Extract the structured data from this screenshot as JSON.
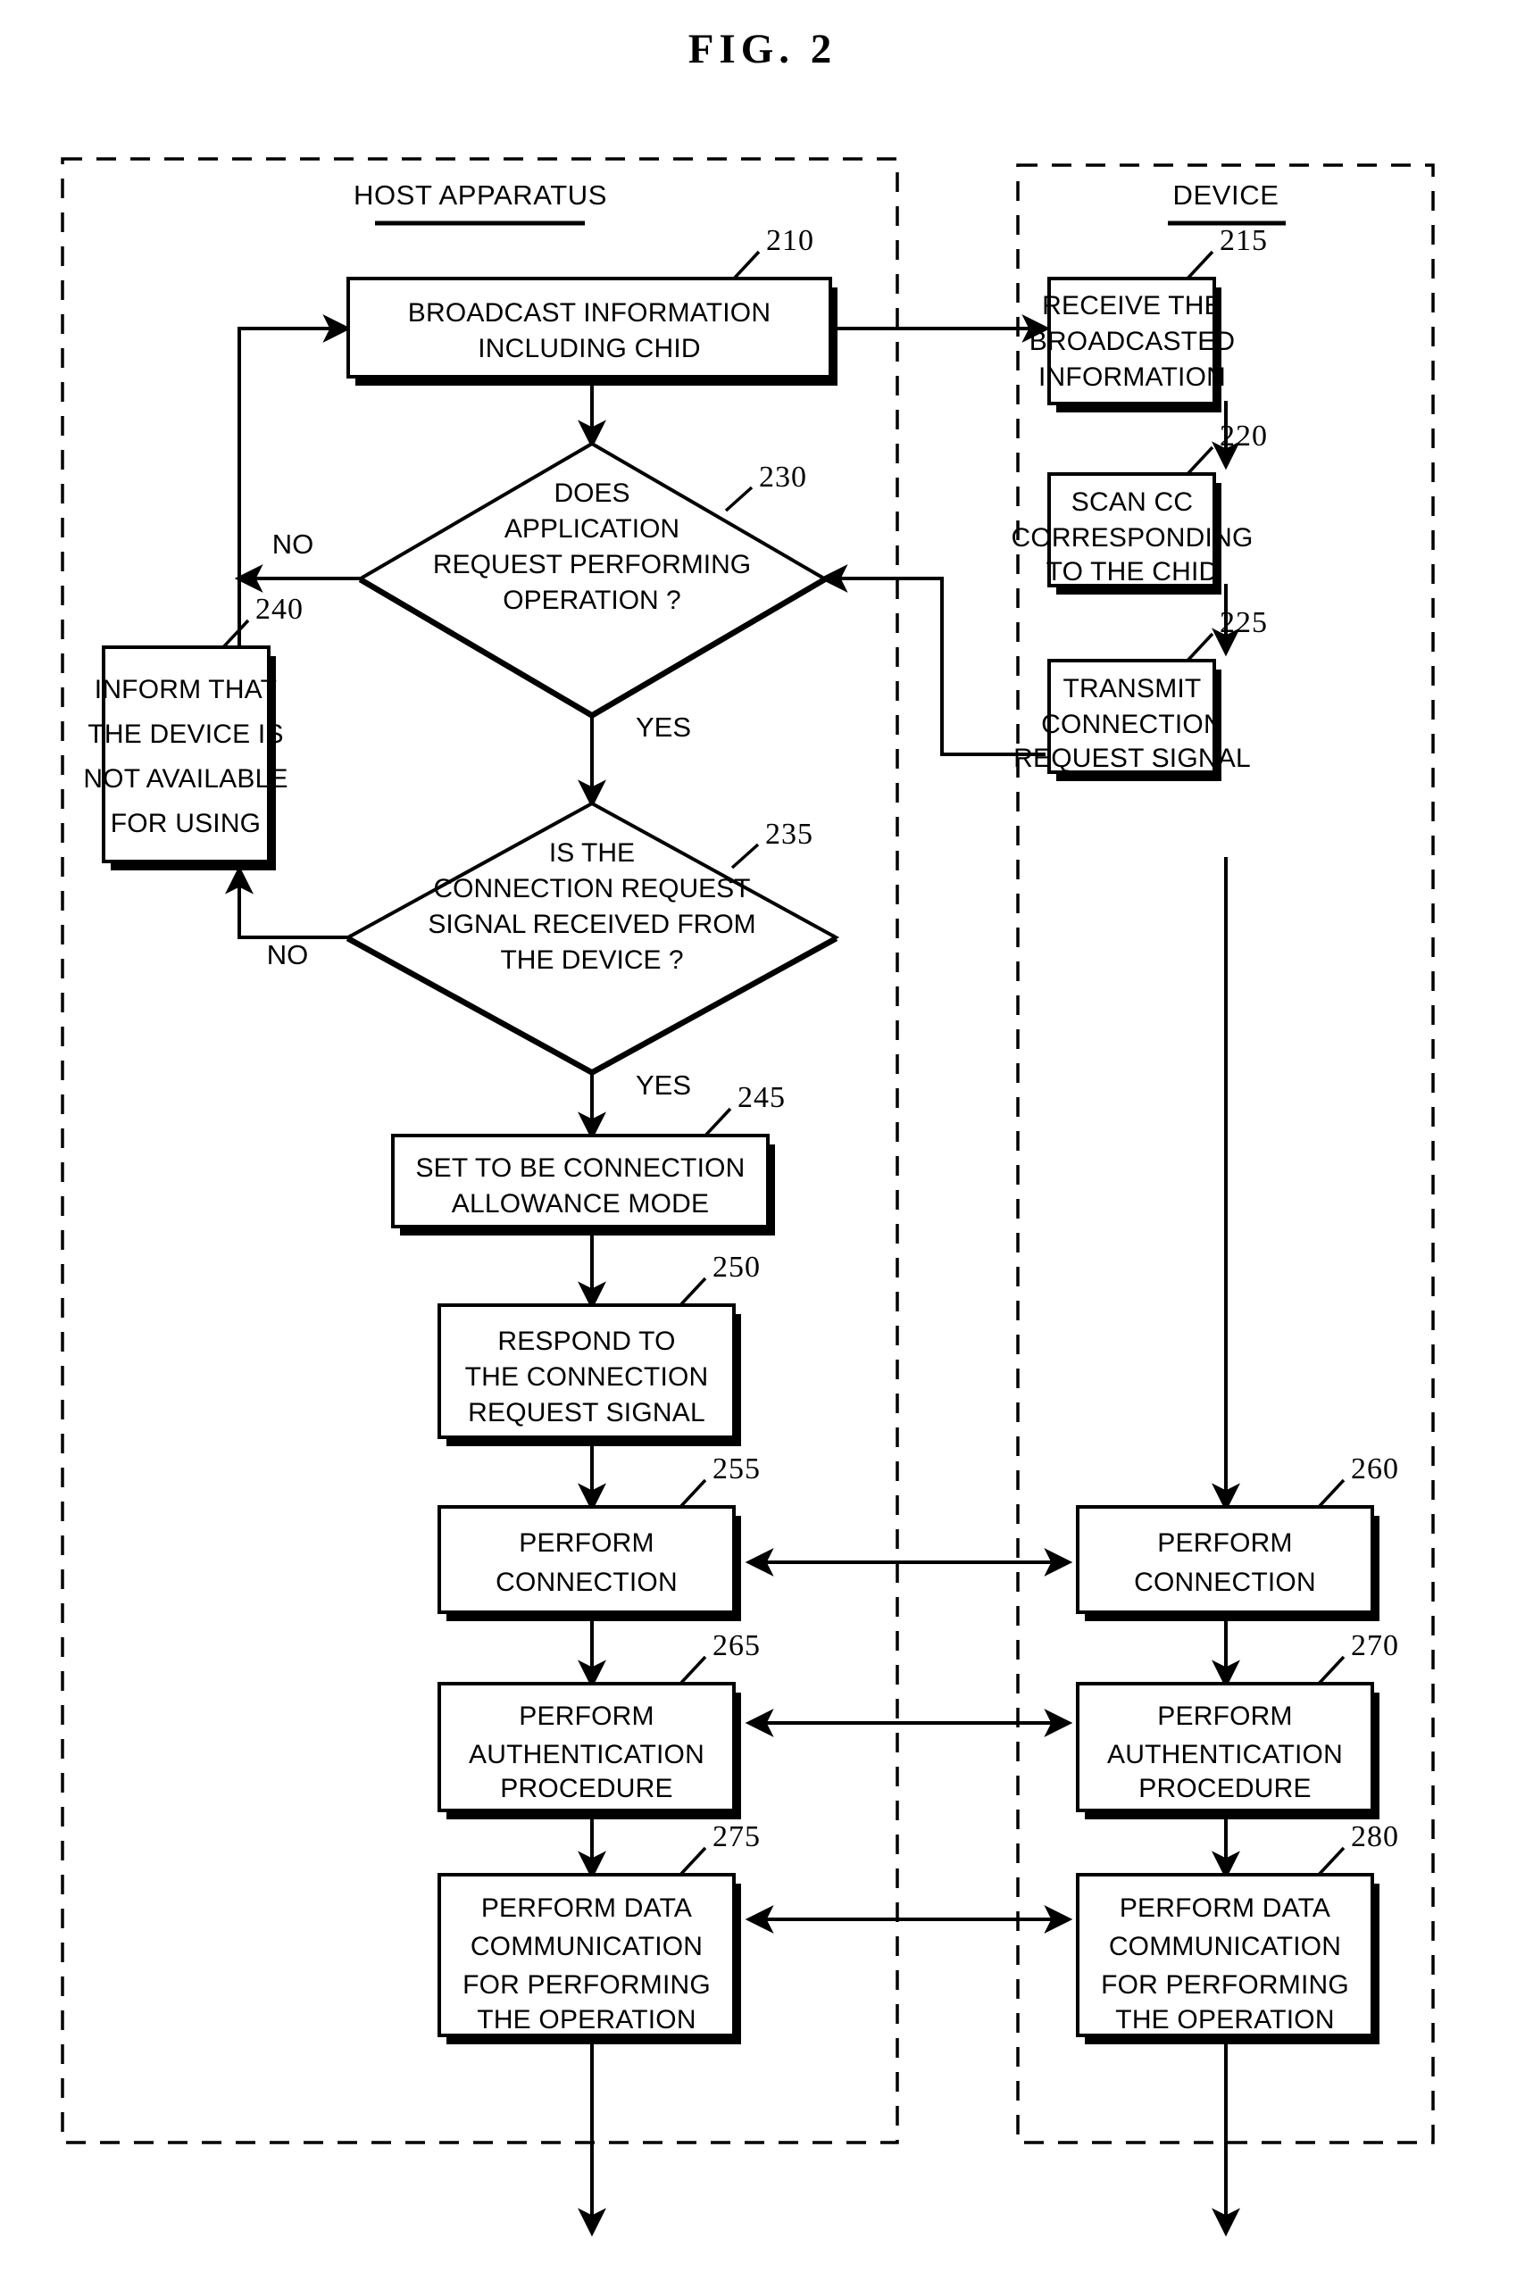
{
  "figure": {
    "title": "FIG.  2"
  },
  "panels": [
    {
      "id": "host",
      "title": "HOST APPARATUS"
    },
    {
      "id": "device",
      "title": "DEVICE"
    }
  ],
  "nodes": [
    {
      "ref": "210",
      "shape": "process",
      "lane": "host",
      "lines": [
        "BROADCAST INFORMATION",
        "INCLUDING CHID"
      ]
    },
    {
      "ref": "215",
      "shape": "process",
      "lane": "device",
      "lines": [
        "RECEIVE THE",
        "BROADCASTED",
        "INFORMATION"
      ]
    },
    {
      "ref": "220",
      "shape": "process",
      "lane": "device",
      "lines": [
        "SCAN CC",
        "CORRESPONDING",
        "TO THE CHID"
      ]
    },
    {
      "ref": "225",
      "shape": "process",
      "lane": "device",
      "lines": [
        "TRANSMIT",
        "CONNECTION",
        "REQUEST SIGNAL"
      ]
    },
    {
      "ref": "230",
      "shape": "decision",
      "lane": "host",
      "lines": [
        "DOES",
        "APPLICATION",
        "REQUEST PERFORMING",
        "OPERATION ?"
      ]
    },
    {
      "ref": "235",
      "shape": "decision",
      "lane": "host",
      "lines": [
        "IS THE",
        "CONNECTION REQUEST",
        "SIGNAL RECEIVED FROM",
        "THE DEVICE ?"
      ]
    },
    {
      "ref": "240",
      "shape": "process",
      "lane": "host",
      "lines": [
        "INFORM THAT",
        "THE DEVICE IS",
        "NOT AVAILABLE",
        "FOR USING"
      ]
    },
    {
      "ref": "245",
      "shape": "process",
      "lane": "host",
      "lines": [
        "SET TO BE CONNECTION",
        "ALLOWANCE MODE"
      ]
    },
    {
      "ref": "250",
      "shape": "process",
      "lane": "host",
      "lines": [
        "RESPOND TO",
        "THE CONNECTION",
        "REQUEST SIGNAL"
      ]
    },
    {
      "ref": "255",
      "shape": "process",
      "lane": "host",
      "lines": [
        "PERFORM",
        "CONNECTION"
      ]
    },
    {
      "ref": "260",
      "shape": "process",
      "lane": "device",
      "lines": [
        "PERFORM",
        "CONNECTION"
      ]
    },
    {
      "ref": "265",
      "shape": "process",
      "lane": "host",
      "lines": [
        "PERFORM",
        "AUTHENTICATION",
        "PROCEDURE"
      ]
    },
    {
      "ref": "270",
      "shape": "process",
      "lane": "device",
      "lines": [
        "PERFORM",
        "AUTHENTICATION",
        "PROCEDURE"
      ]
    },
    {
      "ref": "275",
      "shape": "process",
      "lane": "host",
      "lines": [
        "PERFORM DATA",
        "COMMUNICATION",
        "FOR PERFORMING",
        "THE OPERATION"
      ]
    },
    {
      "ref": "280",
      "shape": "process",
      "lane": "device",
      "lines": [
        "PERFORM DATA",
        "COMMUNICATION",
        "FOR PERFORMING",
        "THE OPERATION"
      ]
    }
  ],
  "branch_labels": {
    "no_230": "NO",
    "yes_230": "YES",
    "no_235": "NO",
    "yes_235": "YES"
  },
  "colors": {
    "ink": "#000000",
    "paper": "#ffffff"
  }
}
